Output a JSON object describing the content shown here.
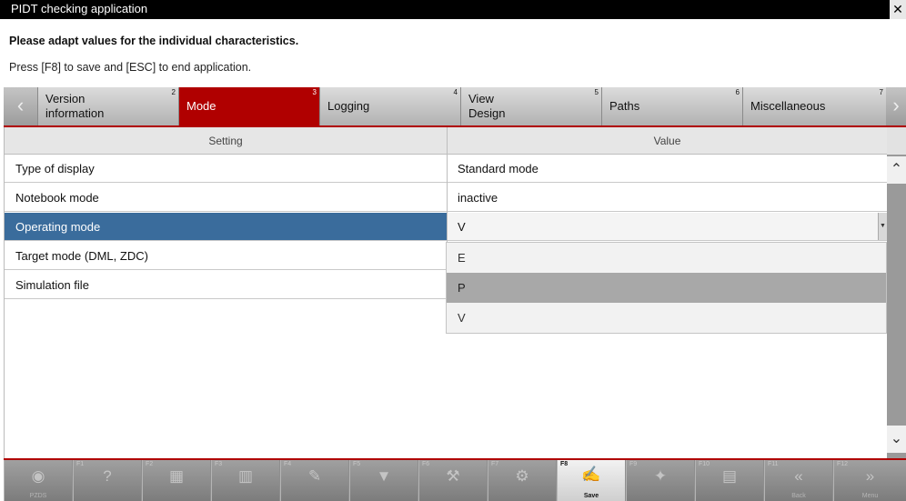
{
  "window": {
    "title": "PIDT checking application",
    "close_glyph": "✕"
  },
  "instructions": {
    "heading": "Please adapt values for the individual characteristics.",
    "subline": "Press [F8] to save and [ESC] to end application."
  },
  "tabs": [
    {
      "label": "Version information",
      "num": "2",
      "active": false
    },
    {
      "label": "Mode",
      "num": "3",
      "active": true
    },
    {
      "label": "Logging",
      "num": "4",
      "active": false
    },
    {
      "label": "View Design",
      "num": "5",
      "active": false
    },
    {
      "label": "Paths",
      "num": "6",
      "active": false
    },
    {
      "label": "Miscellaneous",
      "num": "7",
      "active": false
    }
  ],
  "table": {
    "columns": [
      "Setting",
      "Value"
    ],
    "rows": [
      {
        "setting": "Type of display",
        "value": "Standard mode"
      },
      {
        "setting": "Notebook mode",
        "value": "inactive"
      },
      {
        "setting": "Operating mode",
        "value": "V"
      },
      {
        "setting": "Target mode (DML, ZDC)",
        "value": ""
      },
      {
        "setting": "Simulation file",
        "value": ""
      }
    ],
    "selected_row": 2
  },
  "dropdown": {
    "options": [
      "E",
      "P",
      "V"
    ],
    "highlighted": "P"
  },
  "fkeys": [
    {
      "key": "",
      "icon": "car-search-icon",
      "glyph": "◉",
      "caption": "PZDS"
    },
    {
      "key": "F1",
      "icon": "help-icon",
      "glyph": "?",
      "caption": ""
    },
    {
      "key": "F2",
      "icon": "image-icon",
      "glyph": "▦",
      "caption": ""
    },
    {
      "key": "F3",
      "icon": "chart-icon",
      "glyph": "▥",
      "caption": ""
    },
    {
      "key": "F4",
      "icon": "edit-icon",
      "glyph": "✎",
      "caption": ""
    },
    {
      "key": "F5",
      "icon": "filter-icon",
      "glyph": "▼",
      "caption": ""
    },
    {
      "key": "F6",
      "icon": "tools-icon",
      "glyph": "⚒",
      "caption": ""
    },
    {
      "key": "F7",
      "icon": "settings-icon",
      "glyph": "⚙",
      "caption": ""
    },
    {
      "key": "F8",
      "icon": "save-icon",
      "glyph": "✍",
      "caption": "Save",
      "on": true
    },
    {
      "key": "F9",
      "icon": "speech-icon",
      "glyph": "✦",
      "caption": ""
    },
    {
      "key": "F10",
      "icon": "print-icon",
      "glyph": "▤",
      "caption": ""
    },
    {
      "key": "F11",
      "icon": "back-icon",
      "glyph": "«",
      "caption": "Back"
    },
    {
      "key": "F12",
      "icon": "forward-icon",
      "glyph": "»",
      "caption": "Menu"
    }
  ],
  "colors": {
    "accent_red": "#b00000",
    "selection_blue": "#3a6c9c"
  }
}
